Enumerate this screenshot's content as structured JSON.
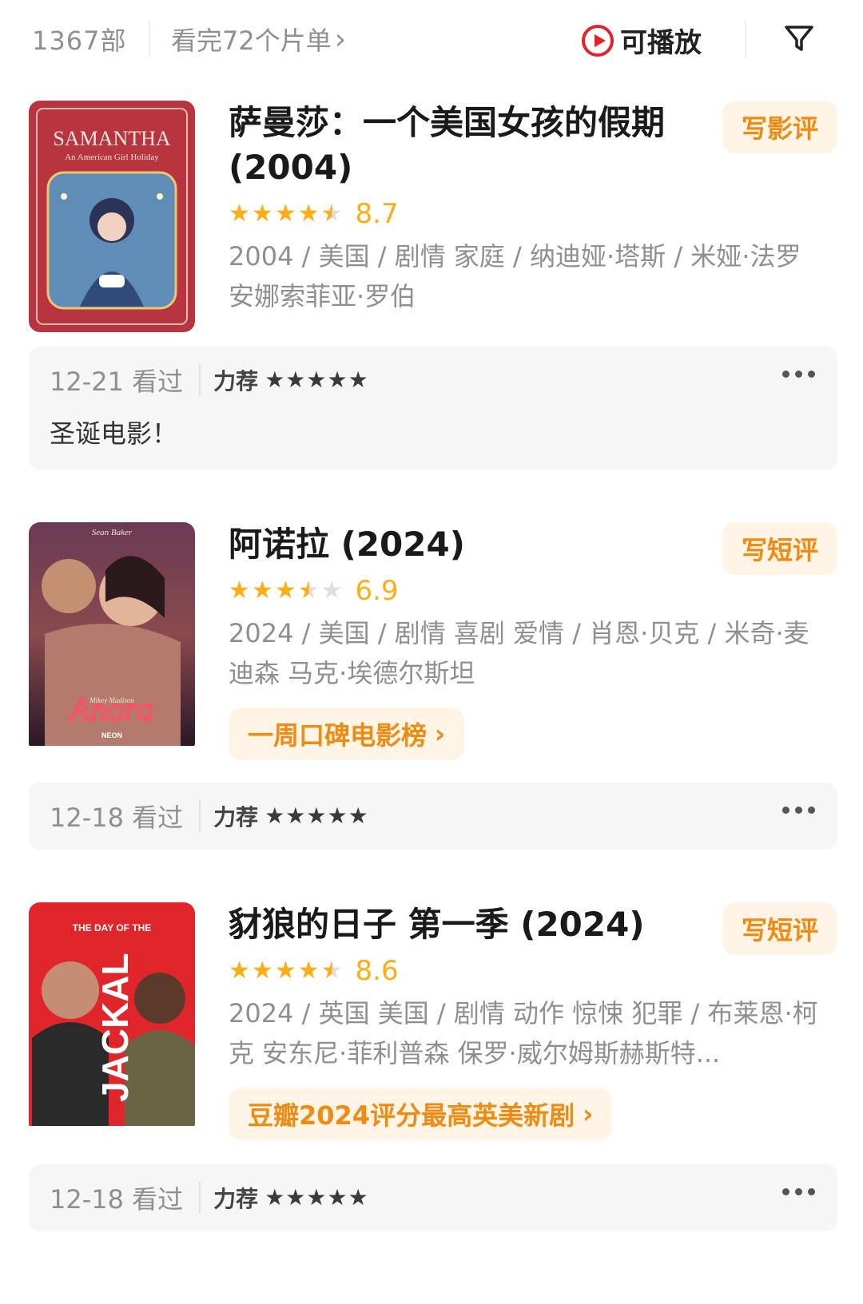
{
  "header": {
    "count": "1367部",
    "lists_link": "看完72个片单",
    "lists_chevron": "›",
    "play_filter": "可播放",
    "icons": {
      "play": "play-circle-icon",
      "filter": "filter-funnel-icon"
    },
    "accent": "#e8202a"
  },
  "items": [
    {
      "title": "萨曼莎：一个美国女孩的假期 (2004)",
      "rating_stars": 4.5,
      "score": "8.7",
      "meta": "2004 / 美国 / 剧情 家庭 / 纳迪娅·塔斯 / 米娅·法罗 安娜索菲亚·罗伯",
      "action": "写影评",
      "poster": {
        "title": "SAMANTHA",
        "subtitle": "An American Girl Holiday"
      },
      "note": {
        "date": "12-21 看过",
        "rec": "力荐",
        "stars": 5,
        "comment": "圣诞电影！"
      }
    },
    {
      "title": "阿诺拉 (2024)",
      "rating_stars": 3.5,
      "score": "6.9",
      "meta": "2024 / 美国 / 剧情 喜剧 爱情 / 肖恩·贝克 / 米奇·麦迪森 马克·埃德尔斯坦",
      "action": "写短评",
      "rank_tag": "一周口碑电影榜",
      "poster": {
        "credit": "Sean Baker",
        "title": "Anora",
        "actress": "Mikey Madison",
        "distributor": "NEON"
      },
      "note": {
        "date": "12-18 看过",
        "rec": "力荐",
        "stars": 5
      }
    },
    {
      "title": "豺狼的日子 第一季 (2024)",
      "rating_stars": 4.5,
      "score": "8.6",
      "meta": "2024 / 英国 美国 / 剧情 动作 惊悚 犯罪 / 布莱恩·柯克 安东尼·菲利普森 保罗·威尔姆斯赫斯特...",
      "action": "写短评",
      "rank_tag": "豆瓣2024评分最高英美新剧",
      "poster": {
        "title_top": "THE DAY OF THE",
        "title_main": "JACKAL"
      },
      "note": {
        "date": "12-18 看过",
        "rec": "力荐",
        "stars": 5
      }
    }
  ],
  "colors": {
    "orange": "#ffad14",
    "tag_bg": "#fff4e6",
    "tag_text": "#f08b12",
    "gray": "#8f8f8f"
  }
}
